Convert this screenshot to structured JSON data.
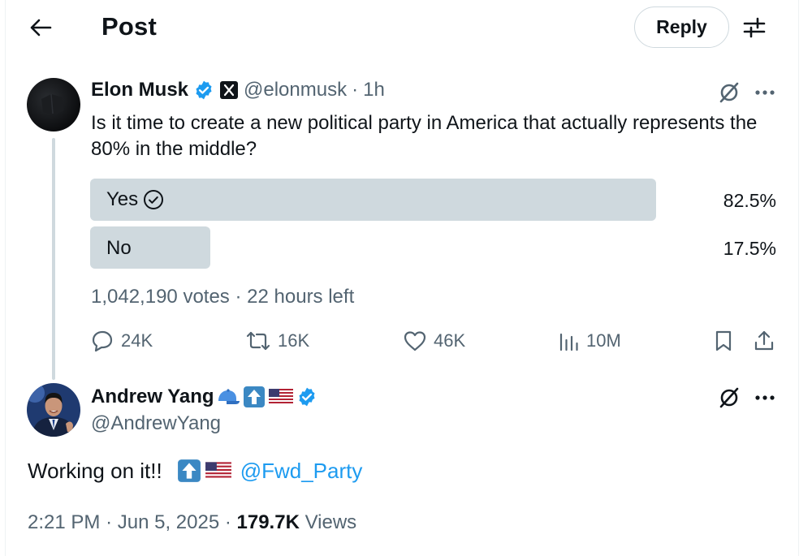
{
  "header": {
    "title": "Post",
    "reply_label": "Reply"
  },
  "quoted_post": {
    "author_name": "Elon Musk",
    "handle": "@elonmusk",
    "time": "1h",
    "text": "Is it time to create a new political party in America that actually represents the 80% in the middle?",
    "poll": {
      "options": [
        {
          "label": "Yes",
          "percent": "82.5%",
          "fraction": 0.825,
          "chosen": true
        },
        {
          "label": "No",
          "percent": "17.5%",
          "fraction": 0.175,
          "chosen": false
        }
      ],
      "votes": "1,042,190 votes",
      "time_left": "22 hours left"
    },
    "actions": {
      "replies": "24K",
      "reposts": "16K",
      "likes": "46K",
      "views": "10M"
    }
  },
  "reply_post": {
    "author_name": "Andrew Yang",
    "handle": "@AndrewYang",
    "text": "Working on it!!",
    "mention": "@Fwd_Party",
    "time": "2:21 PM",
    "date": "Jun 5, 2025",
    "views_count": "179.7K",
    "views_label": "Views"
  },
  "colors": {
    "accent": "#1d9bf0",
    "secondary_text": "#536471",
    "poll_bar": "#cfd9de"
  },
  "icons": [
    "back-arrow-icon",
    "filter-sliders-icon",
    "verified-badge-icon",
    "x-logo-icon",
    "grok-icon",
    "more-icon",
    "check-circle-icon",
    "reply-icon",
    "repost-icon",
    "like-icon",
    "views-icon",
    "bookmark-icon",
    "share-icon",
    "cap-emoji-icon",
    "up-arrow-emoji-icon",
    "us-flag-emoji-icon"
  ]
}
